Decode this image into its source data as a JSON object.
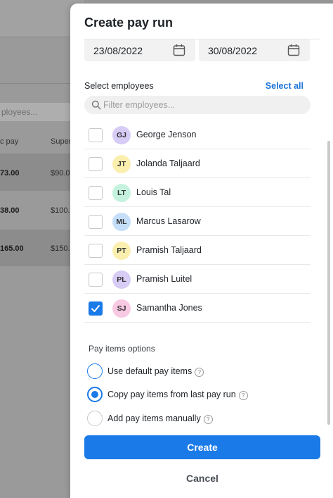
{
  "background": {
    "filter_placeholder": "ployees...",
    "columns": [
      "c pay",
      "Super"
    ],
    "rows": [
      {
        "pay": "73.00",
        "super": "$90.0"
      },
      {
        "pay": "38.00",
        "super": "$100."
      },
      {
        "pay": "165.00",
        "super": "$150."
      }
    ]
  },
  "modal": {
    "title": "Create pay run",
    "date_start": "23/08/2022",
    "date_end": "30/08/2022",
    "select_label": "Select employees",
    "select_all": "Select all",
    "filter_placeholder": "Filter employees...",
    "employees": [
      {
        "initials": "GJ",
        "name": "George Jenson",
        "color": "#d6ccf5",
        "checked": false
      },
      {
        "initials": "JT",
        "name": "Jolanda Taljaard",
        "color": "#fbefb0",
        "checked": false
      },
      {
        "initials": "LT",
        "name": "Louis Tal",
        "color": "#c5f2de",
        "checked": false
      },
      {
        "initials": "ML",
        "name": "Marcus Lasarow",
        "color": "#c5def9",
        "checked": false
      },
      {
        "initials": "PT",
        "name": "Pramish Taljaard",
        "color": "#fbefb0",
        "checked": false
      },
      {
        "initials": "PL",
        "name": "Pramish Luitel",
        "color": "#d6ccf5",
        "checked": false
      },
      {
        "initials": "SJ",
        "name": "Samantha Jones",
        "color": "#f8c9e2",
        "checked": true
      }
    ],
    "pay_items_label": "Pay items options",
    "options": [
      {
        "label": "Use default pay items",
        "state": "outline"
      },
      {
        "label": "Copy pay items from last pay run",
        "state": "selected"
      },
      {
        "label": "Add pay items manually",
        "state": "none"
      }
    ],
    "help_glyph": "?",
    "create_label": "Create",
    "cancel_label": "Cancel",
    "accent": "#1a7ae8"
  }
}
